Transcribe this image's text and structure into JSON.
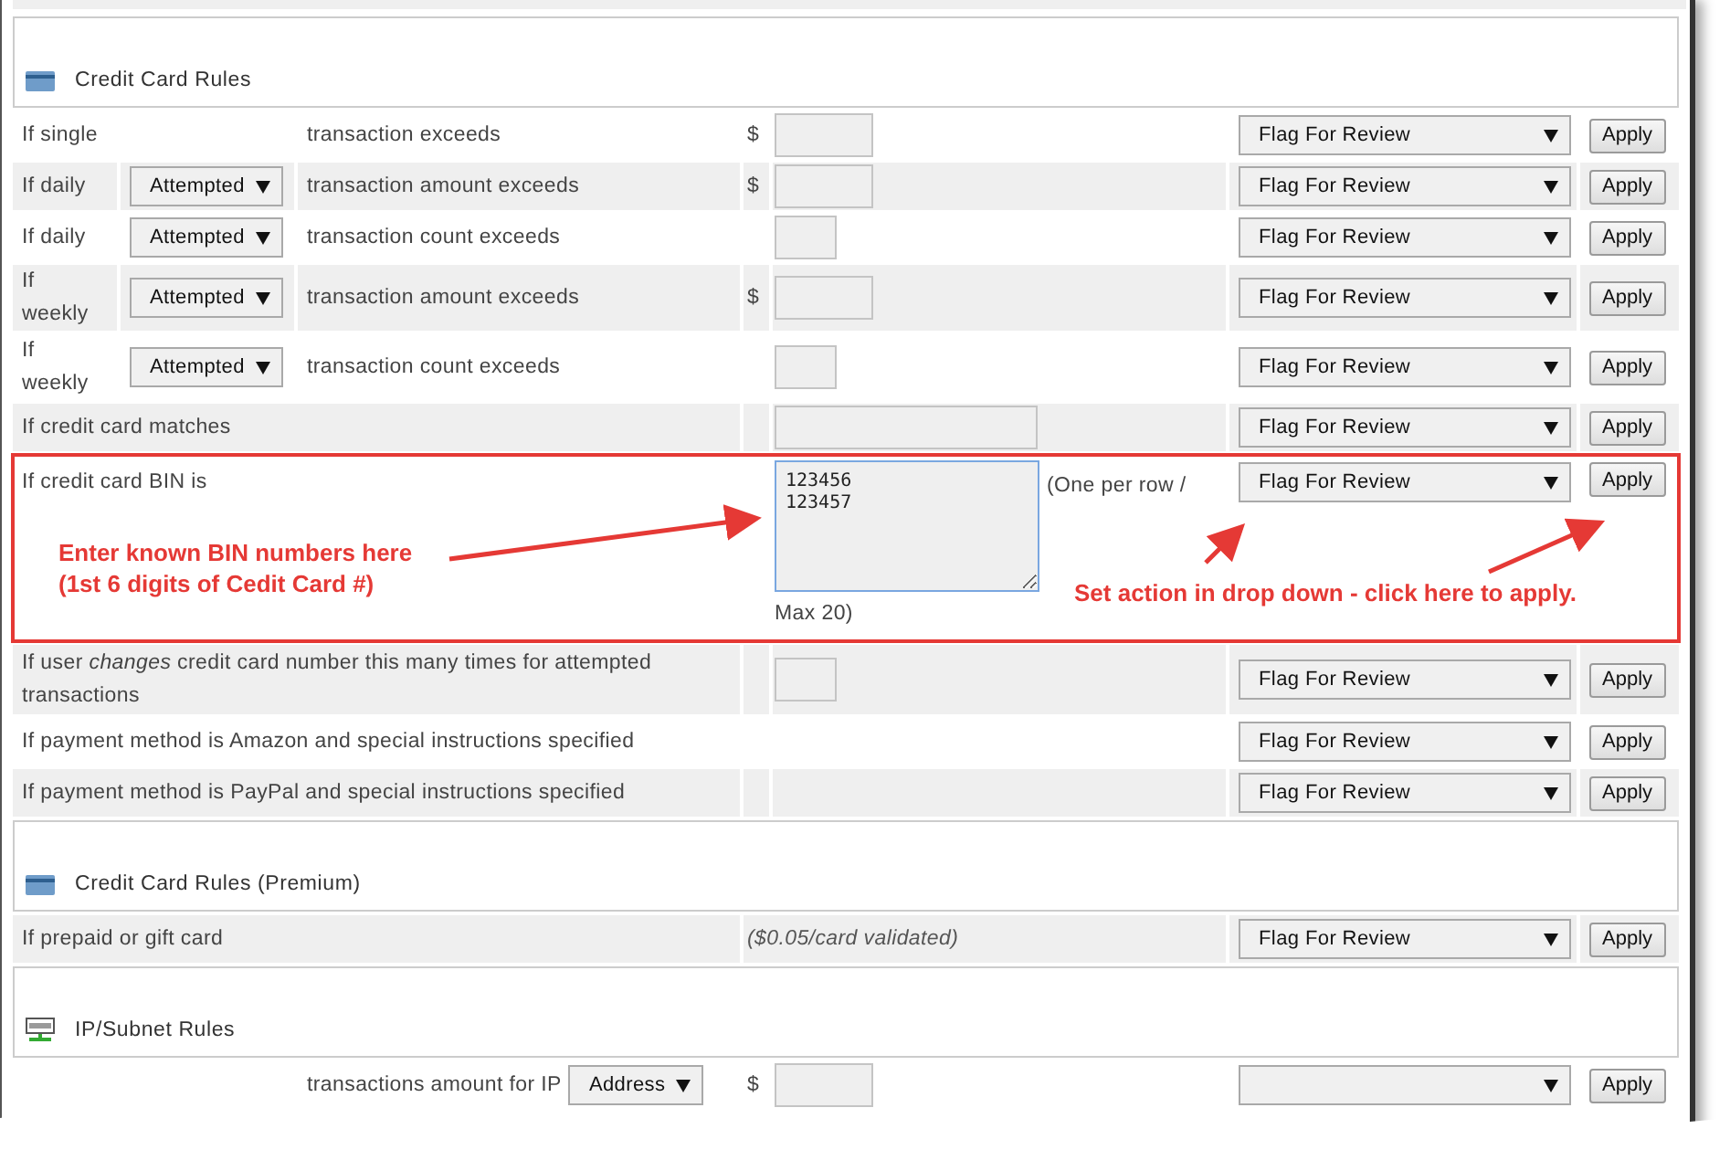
{
  "sections": [
    {
      "title": "Credit Card Rules",
      "kind": "card",
      "rows": [
        {
          "kind": "rule",
          "label": "If single",
          "text": "transaction exceeds",
          "currency": "$",
          "action": "Flag For Review",
          "button": "Apply"
        },
        {
          "kind": "rule",
          "label": "If daily",
          "period": "Attempted",
          "text": "transaction amount exceeds",
          "currency": "$",
          "action": "Flag For Review",
          "button": "Apply"
        },
        {
          "kind": "rule",
          "label": "If daily",
          "period": "Attempted",
          "text": "transaction count exceeds",
          "action": "Flag For Review",
          "button": "Apply"
        },
        {
          "kind": "rule",
          "label": "If weekly",
          "period": "Attempted",
          "text": "transaction amount exceeds",
          "currency": "$",
          "action": "Flag For Review",
          "button": "Apply"
        },
        {
          "kind": "rule",
          "label": "If weekly",
          "period": "Attempted",
          "text": "transaction count exceeds",
          "action": "Flag For Review",
          "button": "Apply"
        },
        {
          "kind": "match",
          "label": "If credit card matches",
          "action": "Flag For Review",
          "button": "Apply"
        },
        {
          "kind": "bin",
          "label": "If credit card BIN is",
          "value": "123456\n123457",
          "hint": "(One per row /",
          "hint_end": "Max 20)",
          "action": "Flag For Review",
          "button": "Apply"
        },
        {
          "kind": "count",
          "label": "If user *changes* credit card number this many times for attempted transactions",
          "action": "Flag For Review",
          "button": "Apply"
        },
        {
          "kind": "plain",
          "label": "If payment method is Amazon and special instructions specified",
          "action": "Flag For Review",
          "button": "Apply"
        },
        {
          "kind": "plain",
          "label": "If payment method is PayPal and special instructions specified",
          "action": "Flag For Review",
          "button": "Apply"
        }
      ]
    },
    {
      "title": "Credit Card Rules (Premium)",
      "kind": "card",
      "rows": [
        {
          "kind": "note",
          "label": "If prepaid or gift card",
          "note": "($0.05/card validated)",
          "action": "Flag For Review",
          "button": "Apply"
        }
      ]
    },
    {
      "title": "IP/Subnet Rules",
      "kind": "network",
      "rows": [
        {
          "kind": "ip",
          "text": "transactions amount for IP",
          "scope": "Address",
          "currency": "$",
          "button": "Apply"
        }
      ]
    }
  ],
  "annotations": [
    {
      "lines": [
        "Enter known BIN numbers here",
        "(1st 6 digits of Cedit Card #)"
      ]
    },
    {
      "lines": [
        "Set action in drop down - click here to apply."
      ]
    }
  ]
}
